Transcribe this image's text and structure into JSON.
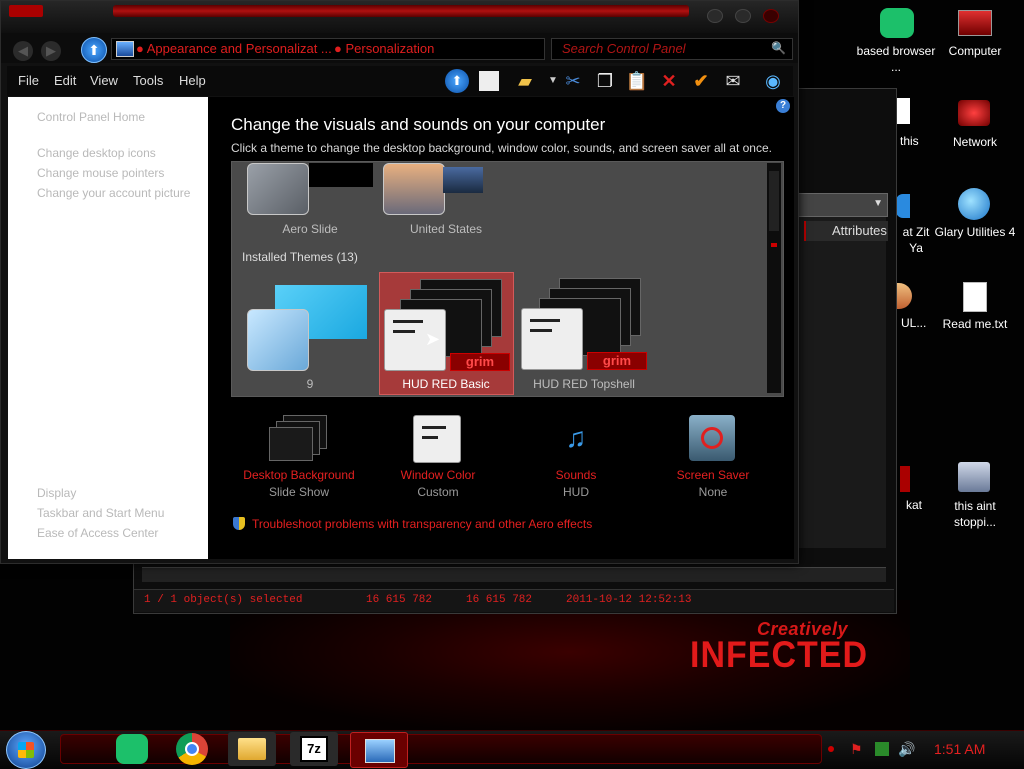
{
  "window": {
    "breadcrumb": [
      "Appearance and Personalizat ...",
      "Personalization"
    ],
    "search_placeholder": "Search Control Panel",
    "menu": [
      "File",
      "Edit",
      "View",
      "Tools",
      "Help"
    ]
  },
  "sidebar": {
    "top_links": [
      "Control Panel Home",
      "Change desktop icons",
      "Change mouse pointers",
      "Change your account picture"
    ],
    "see_also": [
      "Display",
      "Taskbar and Start Menu",
      "Ease of Access Center"
    ]
  },
  "content": {
    "heading": "Change the visuals and sounds on your computer",
    "subtext": "Click a theme to change the desktop background, window color, sounds, and screen saver all at once.",
    "aero_themes": [
      "Aero Slide",
      "United States"
    ],
    "installed_header": "Installed Themes (13)",
    "installed_themes": [
      "9",
      "HUD RED Basic",
      "HUD RED Topshell"
    ],
    "grim_label": "grim",
    "controls": [
      {
        "label": "Desktop Background",
        "sub": "Slide Show"
      },
      {
        "label": "Window Color",
        "sub": "Custom"
      },
      {
        "label": "Sounds",
        "sub": "HUD"
      },
      {
        "label": "Screen Saver",
        "sub": "None"
      }
    ],
    "troubleshoot": "Troubleshoot problems with transparency and other Aero effects"
  },
  "back_window": {
    "column_header": "Attributes",
    "status": [
      "1 / 1 object(s) selected",
      "16 615 782",
      "16 615 782",
      "2011-10-12 12:52:13"
    ]
  },
  "desktop": {
    "icons": [
      {
        "label": "based browser ...",
        "icon": "chat-icon"
      },
      {
        "label": "Computer",
        "icon": "computer-icon"
      },
      {
        "label": "this",
        "icon": "document-icon"
      },
      {
        "label": "Network",
        "icon": "network-icon"
      },
      {
        "label": "at Zit Ya",
        "icon": "app-icon"
      },
      {
        "label": "Glary Utilities 4",
        "icon": "glary-icon"
      },
      {
        "label": "UL...",
        "icon": "disc-icon"
      },
      {
        "label": "Read me.txt",
        "icon": "text-file-icon"
      },
      {
        "label": "kat",
        "icon": "app-icon"
      },
      {
        "label": "this aint stoppi...",
        "icon": "shortcut-icon"
      }
    ],
    "wallpaper_text": [
      "Creatively",
      "INFECTED"
    ]
  },
  "taskbar": {
    "apps": [
      "chat-app",
      "chrome",
      "file-explorer",
      "7zip",
      "control-panel"
    ],
    "app_7z_label": "7z",
    "clock": "1:51 AM"
  }
}
